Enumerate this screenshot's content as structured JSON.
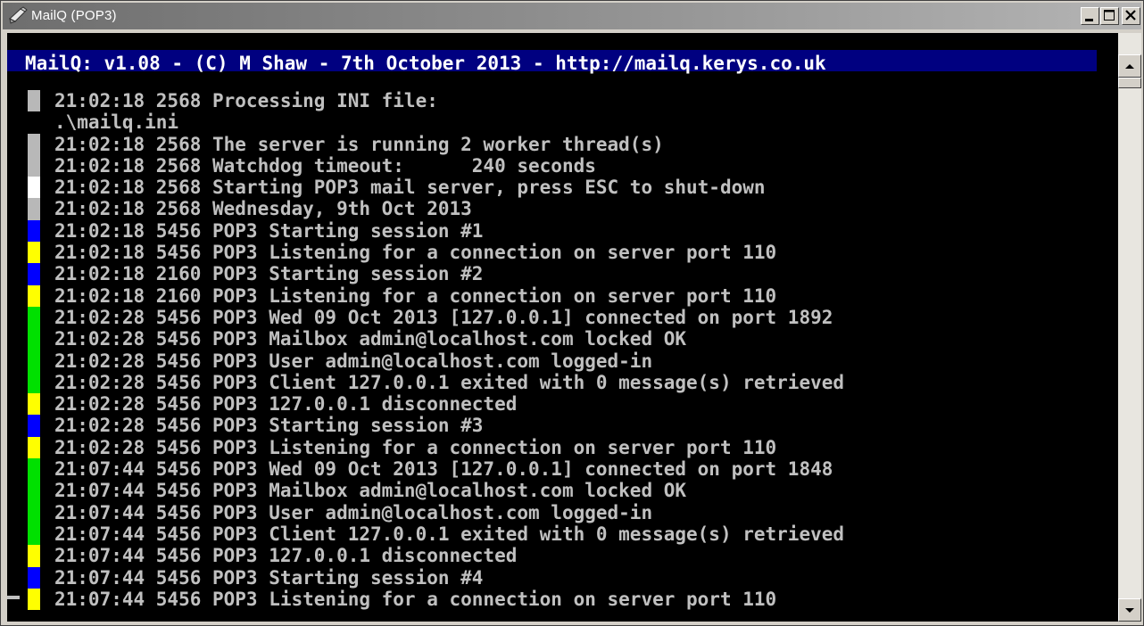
{
  "window": {
    "title": "MailQ (POP3)"
  },
  "console": {
    "banner": "MailQ: v1.08 - (C) M Shaw - 7th October 2013 - http://mailq.kerys.co.uk",
    "lines": [
      {
        "bar": "#b8b8b8",
        "text": "21:02:18 2568 Processing INI file:"
      },
      {
        "bar": null,
        "text": ".\\mailq.ini"
      },
      {
        "bar": "#b8b8b8",
        "text": "21:02:18 2568 The server is running 2 worker thread(s)"
      },
      {
        "bar": "#b8b8b8",
        "text": "21:02:18 2568 Watchdog timeout:      240 seconds"
      },
      {
        "bar": "#ffffff",
        "text": "21:02:18 2568 Starting POP3 mail server, press ESC to shut-down"
      },
      {
        "bar": "#b8b8b8",
        "text": "21:02:18 2568 Wednesday, 9th Oct 2013"
      },
      {
        "bar": "#0000ff",
        "text": "21:02:18 5456 POP3 Starting session #1"
      },
      {
        "bar": "#ffff00",
        "text": "21:02:18 5456 POP3 Listening for a connection on server port 110"
      },
      {
        "bar": "#0000ff",
        "text": "21:02:18 2160 POP3 Starting session #2"
      },
      {
        "bar": "#ffff00",
        "text": "21:02:18 2160 POP3 Listening for a connection on server port 110"
      },
      {
        "bar": "#00e000",
        "text": "21:02:28 5456 POP3 Wed 09 Oct 2013 [127.0.0.1] connected on port 1892"
      },
      {
        "bar": "#00e000",
        "text": "21:02:28 5456 POP3 Mailbox admin@localhost.com locked OK"
      },
      {
        "bar": "#00e000",
        "text": "21:02:28 5456 POP3 User admin@localhost.com logged-in"
      },
      {
        "bar": "#00e000",
        "text": "21:02:28 5456 POP3 Client 127.0.0.1 exited with 0 message(s) retrieved"
      },
      {
        "bar": "#ffff00",
        "text": "21:02:28 5456 POP3 127.0.0.1 disconnected"
      },
      {
        "bar": "#0000ff",
        "text": "21:02:28 5456 POP3 Starting session #3"
      },
      {
        "bar": "#ffff00",
        "text": "21:02:28 5456 POP3 Listening for a connection on server port 110"
      },
      {
        "bar": "#00e000",
        "text": "21:07:44 5456 POP3 Wed 09 Oct 2013 [127.0.0.1] connected on port 1848"
      },
      {
        "bar": "#00e000",
        "text": "21:07:44 5456 POP3 Mailbox admin@localhost.com locked OK"
      },
      {
        "bar": "#00e000",
        "text": "21:07:44 5456 POP3 User admin@localhost.com logged-in"
      },
      {
        "bar": "#00e000",
        "text": "21:07:44 5456 POP3 Client 127.0.0.1 exited with 0 message(s) retrieved"
      },
      {
        "bar": "#ffff00",
        "text": "21:07:44 5456 POP3 127.0.0.1 disconnected"
      },
      {
        "bar": "#0000ff",
        "text": "21:07:44 5456 POP3 Starting session #4"
      },
      {
        "bar": "#ffff00",
        "text": "21:07:44 5456 POP3 Listening for a connection on server port 110"
      }
    ]
  },
  "icons": {
    "app": "mailq-app-icon",
    "minimize": "minimize-icon",
    "maximize": "maximize-icon",
    "close": "close-icon",
    "scroll_up": "scroll-up-arrow-icon",
    "scroll_down": "scroll-down-arrow-icon"
  }
}
